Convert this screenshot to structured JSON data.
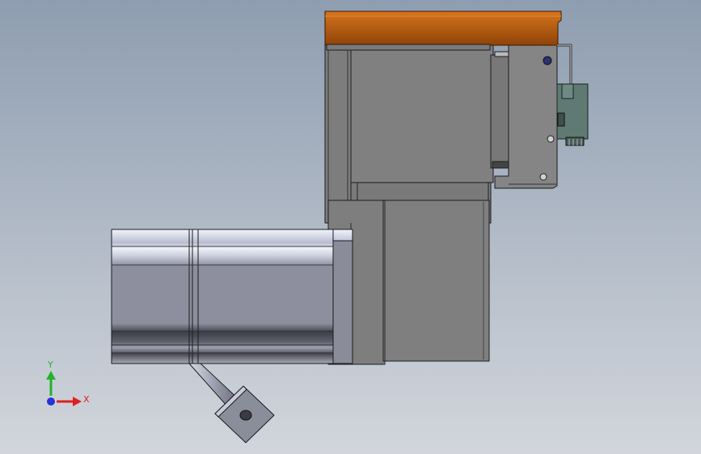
{
  "viewport": {
    "background_top": "#8e9db0",
    "background_bottom": "#d2d6dc"
  },
  "model": {
    "colors": {
      "dark_gray": "#7f7f7f",
      "mid_gray": "#858585",
      "edge": "#1c1c1c",
      "orange_cover": "#b2570f",
      "orange_dark": "#7d3a08",
      "pcb_green": "#5f7b73",
      "metal_light": "#e6e9f2",
      "metal_mid": "#9496a6",
      "metal_dark": "#444650"
    }
  },
  "triad": {
    "x_label": "X",
    "y_label": "Y",
    "x_color": "#e02020",
    "y_color": "#27b02d",
    "z_color": "#2335d8"
  }
}
